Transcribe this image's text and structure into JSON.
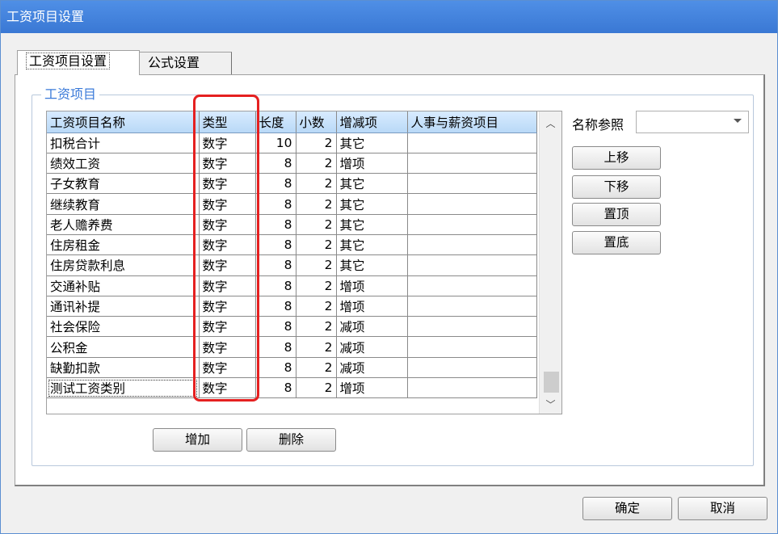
{
  "window": {
    "title": "工资项目设置"
  },
  "tabs": [
    {
      "label": "工资项目设置",
      "active": true
    },
    {
      "label": "公式设置",
      "active": false
    }
  ],
  "group": {
    "title": "工资项目"
  },
  "table": {
    "columns": [
      "工资项目名称",
      "类型",
      "长度",
      "小数",
      "增减项",
      "人事与薪资项目"
    ],
    "rows": [
      [
        "扣税合计",
        "数字",
        "10",
        "2",
        "其它",
        ""
      ],
      [
        "绩效工资",
        "数字",
        "8",
        "2",
        "增项",
        ""
      ],
      [
        "子女教育",
        "数字",
        "8",
        "2",
        "其它",
        ""
      ],
      [
        "继续教育",
        "数字",
        "8",
        "2",
        "其它",
        ""
      ],
      [
        "老人赡养费",
        "数字",
        "8",
        "2",
        "其它",
        ""
      ],
      [
        "住房租金",
        "数字",
        "8",
        "2",
        "其它",
        ""
      ],
      [
        "住房贷款利息",
        "数字",
        "8",
        "2",
        "其它",
        ""
      ],
      [
        "交通补贴",
        "数字",
        "8",
        "2",
        "增项",
        ""
      ],
      [
        "通讯补提",
        "数字",
        "8",
        "2",
        "增项",
        ""
      ],
      [
        "社会保险",
        "数字",
        "8",
        "2",
        "减项",
        ""
      ],
      [
        "公积金",
        "数字",
        "8",
        "2",
        "减项",
        ""
      ],
      [
        "缺勤扣款",
        "数字",
        "8",
        "2",
        "减项",
        ""
      ],
      [
        "测试工资类别",
        "数字",
        "8",
        "2",
        "增项",
        ""
      ]
    ]
  },
  "scrollbar": {
    "up_icon": "chevron-up-icon",
    "down_icon": "chevron-down-icon",
    "up_glyph": "︿",
    "down_glyph": "﹀"
  },
  "side": {
    "ref_label": "名称参照",
    "ref_value": "",
    "move_up": "上移",
    "move_down": "下移",
    "move_top": "置顶",
    "move_bottom": "置底"
  },
  "bottom": {
    "add": "增加",
    "delete": "删除"
  },
  "footer": {
    "ok": "确定",
    "cancel": "取消"
  },
  "colors": {
    "title_bar": "#3a78d4",
    "header": "#b9d9f7",
    "highlight": "#e52020",
    "legend": "#3a7ad9"
  }
}
